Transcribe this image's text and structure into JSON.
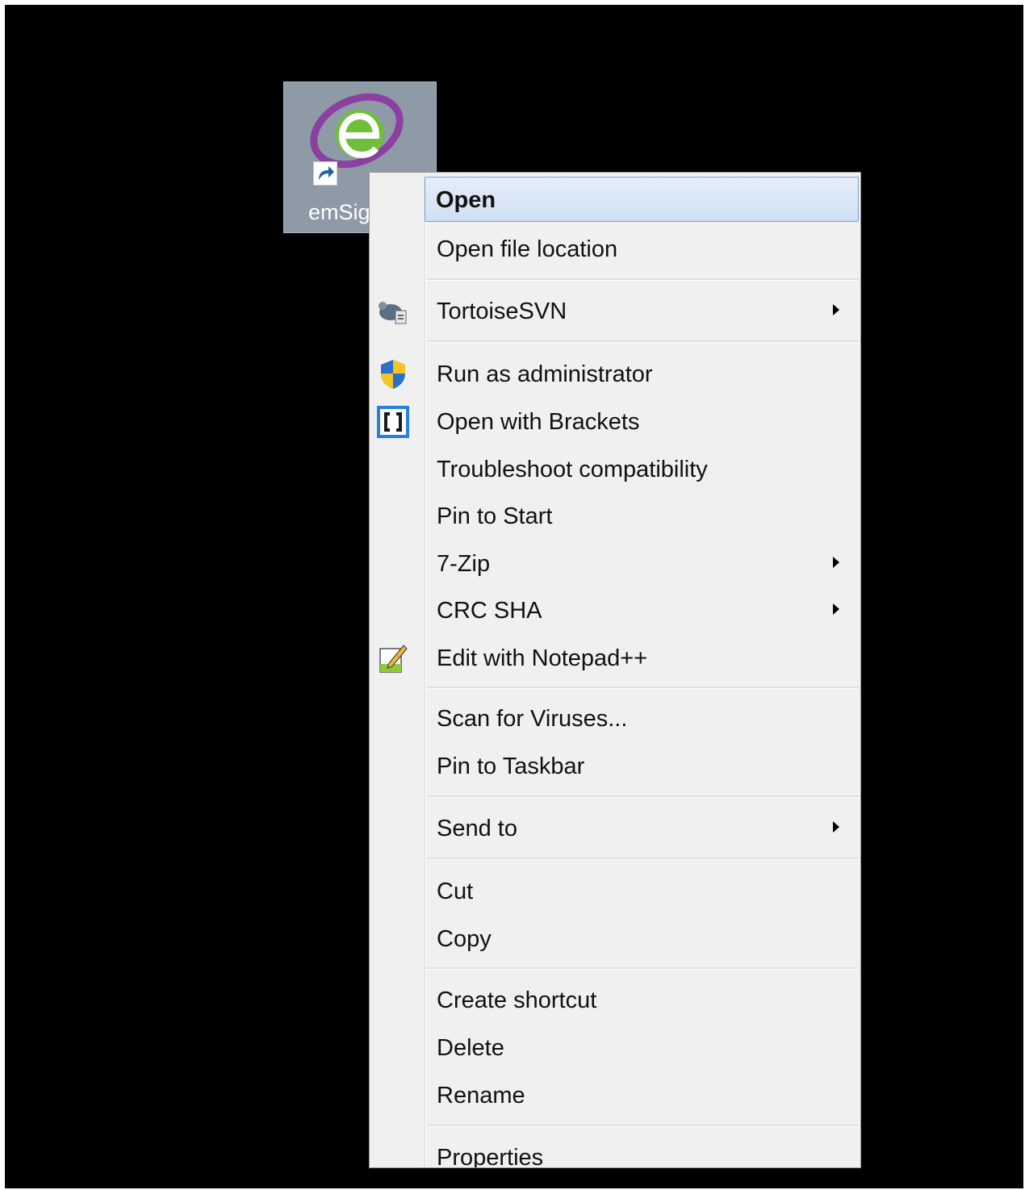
{
  "desktop": {
    "icon_label": "emSig",
    "icon_name": "emsigner-app-icon",
    "background_color": "#000000"
  },
  "context_menu": {
    "highlight_color": "#cfe0f4",
    "items": [
      {
        "label": "Open",
        "bold": true
      },
      {
        "label": "Open file location"
      },
      {
        "label": "TortoiseSVN",
        "icon": "tortoise-icon",
        "submenu": true
      },
      {
        "label": "Run as administrator",
        "icon": "uac-shield-icon"
      },
      {
        "label": "Open with Brackets",
        "icon": "brackets-icon"
      },
      {
        "label": "Troubleshoot compatibility"
      },
      {
        "label": "Pin to Start"
      },
      {
        "label": "7-Zip",
        "submenu": true
      },
      {
        "label": "CRC SHA",
        "submenu": true
      },
      {
        "label": "Edit with Notepad++",
        "icon": "notepad-plus-plus-icon"
      },
      {
        "label": "Scan for Viruses..."
      },
      {
        "label": "Pin to Taskbar"
      },
      {
        "label": "Send to",
        "submenu": true
      },
      {
        "label": "Cut"
      },
      {
        "label": "Copy"
      },
      {
        "label": "Create shortcut"
      },
      {
        "label": "Delete"
      },
      {
        "label": "Rename"
      },
      {
        "label": "Properties"
      }
    ]
  }
}
